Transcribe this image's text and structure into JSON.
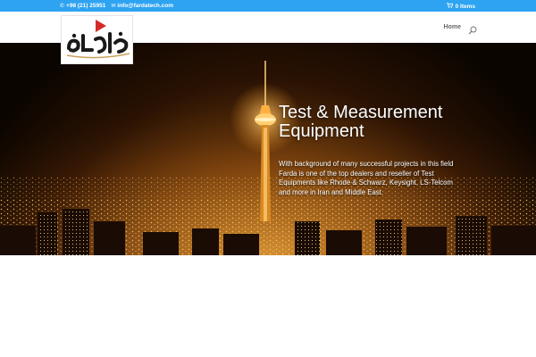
{
  "topbar": {
    "phone": "+98 (21) 25951",
    "email": "info@fardatech.com",
    "cart_label": "0 Items",
    "color": "#2ea3f2"
  },
  "header": {
    "logo_text": "فردا",
    "nav": [
      {
        "label": "Home"
      }
    ]
  },
  "hero": {
    "title": "Test & Measurement Equipment",
    "description": "With background of many successful projects in this field Farda is one of the top dealers and reseller of Test Equipments like Rhode & Schwarz, Keysight, LS-Telcom and more in Iran and Middle East."
  },
  "icons": {
    "phone": "phone-icon",
    "email": "envelope-icon",
    "cart": "cart-icon",
    "search": "search-icon"
  }
}
